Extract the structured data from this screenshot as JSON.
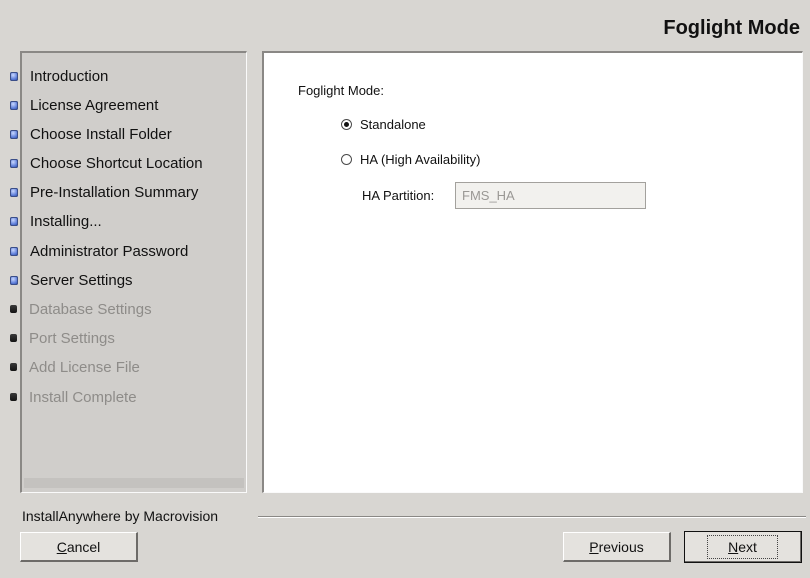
{
  "window": {
    "title": "Foglight Mode"
  },
  "steps": [
    {
      "label": "Introduction",
      "state": "done"
    },
    {
      "label": "License Agreement",
      "state": "done"
    },
    {
      "label": "Choose Install Folder",
      "state": "done"
    },
    {
      "label": "Choose Shortcut Location",
      "state": "done"
    },
    {
      "label": "Pre-Installation Summary",
      "state": "done"
    },
    {
      "label": "Installing...",
      "state": "done"
    },
    {
      "label": "Administrator Password",
      "state": "done"
    },
    {
      "label": "Server Settings",
      "state": "current"
    },
    {
      "label": "Database Settings",
      "state": "pending"
    },
    {
      "label": "Port Settings",
      "state": "pending"
    },
    {
      "label": "Add License File",
      "state": "pending"
    },
    {
      "label": "Install Complete",
      "state": "pending"
    }
  ],
  "form": {
    "mode_label": "Foglight Mode:",
    "options": [
      {
        "label": "Standalone",
        "checked": true
      },
      {
        "label": "HA (High Availability)",
        "checked": false
      }
    ],
    "partition_label": "HA Partition:",
    "partition_value": "FMS_HA"
  },
  "footer": {
    "vendor": "InstallAnywhere by Macrovision",
    "cancel": "Cancel",
    "previous": "Previous",
    "next": "Next"
  },
  "colors": {
    "active_bullet": "#5b7cd8",
    "pending_bullet": "#1e1e1e",
    "pending_text": "#8e8c89"
  }
}
